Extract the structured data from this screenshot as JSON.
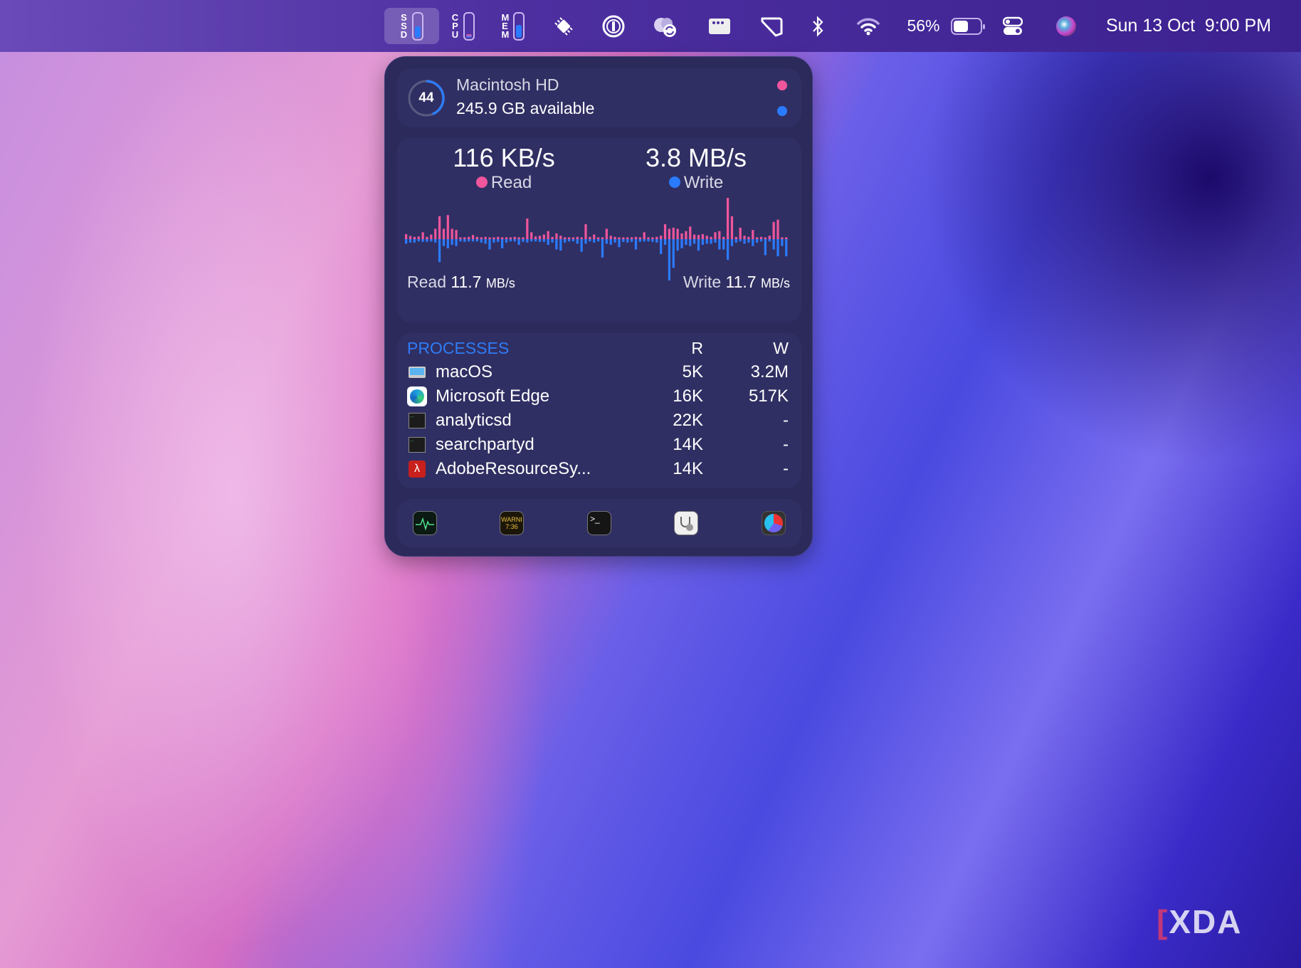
{
  "menubar": {
    "ssd_label": "SSD",
    "cpu_label": "CPU",
    "mem_label": "MEM",
    "ssd_level": 0.5,
    "cpu_level": 0.15,
    "mem_level": 0.55,
    "battery_percent": "56%",
    "battery_level": 0.56,
    "datetime": "Sun 13 Oct  9:00 PM",
    "icons": [
      "cpu-chip-icon",
      "1password-icon",
      "cloud-sync-icon",
      "window-dots-icon",
      "hand-mirror-icon",
      "bluetooth-icon",
      "wifi-icon",
      "battery-icon",
      "control-center-icon",
      "siri-icon"
    ]
  },
  "disk": {
    "used_percent": "44",
    "used_fraction": 0.44,
    "name": "Macintosh HD",
    "available": "245.9 GB available"
  },
  "io": {
    "read_rate": "116 KB/s",
    "read_label": "Read",
    "write_rate": "3.8 MB/s",
    "write_label": "Write",
    "read_max_label": "Read",
    "read_max_value": "11.7",
    "read_max_unit": "MB/s",
    "write_max_label": "Write",
    "write_max_value": "11.7",
    "write_max_unit": "MB/s"
  },
  "colors": {
    "read": "#f0569c",
    "write": "#2a7bff",
    "accent": "#2f7cf6",
    "panel": "#2b2a5a"
  },
  "chart_data": {
    "type": "bar",
    "title": "Disk read/write activity",
    "series": [
      {
        "name": "Read",
        "values": [
          22,
          14,
          10,
          12,
          30,
          10,
          20,
          45,
          100,
          45,
          105,
          45,
          40,
          8,
          8,
          10,
          18,
          10,
          8,
          10,
          8,
          8,
          10,
          8,
          8,
          8,
          10,
          8,
          8,
          90,
          30,
          12,
          15,
          20,
          35,
          10,
          25,
          15,
          8,
          8,
          8,
          10,
          8,
          65,
          10,
          20,
          8,
          8,
          45,
          15,
          10,
          8,
          8,
          8,
          8,
          10,
          8,
          30,
          8,
          8,
          10,
          15,
          65,
          45,
          50,
          45,
          25,
          35,
          55,
          20,
          18,
          22,
          15,
          10,
          30,
          35,
          10,
          180,
          100,
          10,
          50,
          15,
          10,
          40,
          8,
          10,
          8,
          15,
          75,
          85,
          8,
          8
        ]
      },
      {
        "name": "Write",
        "values": [
          20,
          15,
          15,
          10,
          12,
          12,
          10,
          15,
          100,
          30,
          40,
          25,
          30,
          10,
          12,
          10,
          10,
          10,
          15,
          20,
          45,
          15,
          12,
          40,
          15,
          10,
          10,
          25,
          12,
          15,
          10,
          10,
          12,
          12,
          25,
          15,
          45,
          50,
          15,
          10,
          10,
          20,
          55,
          20,
          10,
          15,
          10,
          80,
          20,
          25,
          15,
          35,
          12,
          15,
          12,
          45,
          12,
          10,
          10,
          12,
          15,
          65,
          25,
          180,
          125,
          50,
          40,
          25,
          30,
          20,
          50,
          25,
          20,
          20,
          15,
          45,
          45,
          90,
          30,
          15,
          10,
          20,
          15,
          30,
          15,
          10,
          70,
          10,
          45,
          75,
          30,
          75
        ]
      }
    ]
  },
  "processes": {
    "title": "PROCESSES",
    "col_r": "R",
    "col_w": "W",
    "rows": [
      {
        "icon": "laptop-icon",
        "name": "macOS",
        "r": "5K",
        "w": "3.2M"
      },
      {
        "icon": "edge-icon",
        "name": "Microsoft Edge",
        "r": "16K",
        "w": "517K"
      },
      {
        "icon": "terminal-exec-icon",
        "name": "analyticsd",
        "r": "22K",
        "w": "-"
      },
      {
        "icon": "terminal-exec-icon",
        "name": "searchpartyd",
        "r": "14K",
        "w": "-"
      },
      {
        "icon": "acrobat-icon",
        "name": "AdobeResourceSy...",
        "r": "14K",
        "w": "-"
      }
    ]
  },
  "dock": {
    "console_text": "WARNI\n7:36",
    "apps": [
      "activity-monitor-icon",
      "console-icon",
      "terminal-icon",
      "disk-utility-icon",
      "istat-menus-icon"
    ]
  },
  "watermark": "XDA"
}
